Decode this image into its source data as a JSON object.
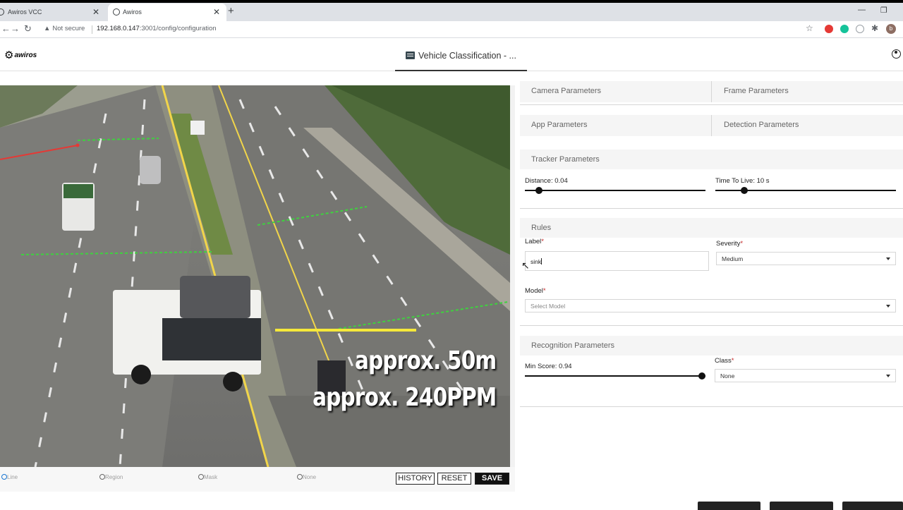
{
  "browser": {
    "tabs": [
      {
        "title": "Awiros VCC",
        "active": false
      },
      {
        "title": "Awiros",
        "active": true
      }
    ],
    "new_tab_icon": "plus-icon",
    "security_label": "Not secure",
    "url_host": "192.168.0.147",
    "url_path": ":3001/config/configuration",
    "profile_initial": "b"
  },
  "app": {
    "logo_text": "awiros",
    "title": "Vehicle Classification - ..."
  },
  "video": {
    "overlay_line1": "approx. 50m",
    "overlay_line2": "approx. 240PPM"
  },
  "draw_modes": [
    "Line",
    "Region",
    "Mask",
    "None"
  ],
  "selected_draw_mode": "Line",
  "actions": {
    "history": "HISTORY",
    "reset": "RESET",
    "save": "SAVE"
  },
  "sections": {
    "camera": "Camera Parameters",
    "frame": "Frame Parameters",
    "app": "App Parameters",
    "detection": "Detection Parameters",
    "tracker": "Tracker Parameters",
    "rules": "Rules",
    "recognition": "Recognition Parameters"
  },
  "tracker": {
    "distance_label": "Distance: 0.04",
    "distance_value": 0.04,
    "ttl_label": "Time To Live: 10 s",
    "ttl_fraction": 0.12
  },
  "rules": {
    "label_title": "Label",
    "label_value": "sink",
    "severity_title": "Severity",
    "severity_value": "Medium",
    "model_title": "Model",
    "model_placeholder": "Select Model",
    "required_mark": "*"
  },
  "recognition": {
    "min_score_label": "Min Score: 0.94",
    "min_score_value": 0.94,
    "class_title": "Class",
    "class_value": "None"
  },
  "colors": {
    "save_button_bg": "#111111",
    "required_star": "#c62828",
    "overlay_green": "#3fd13f",
    "overlay_red": "#e53935",
    "overlay_yellow": "#f5e83a"
  }
}
